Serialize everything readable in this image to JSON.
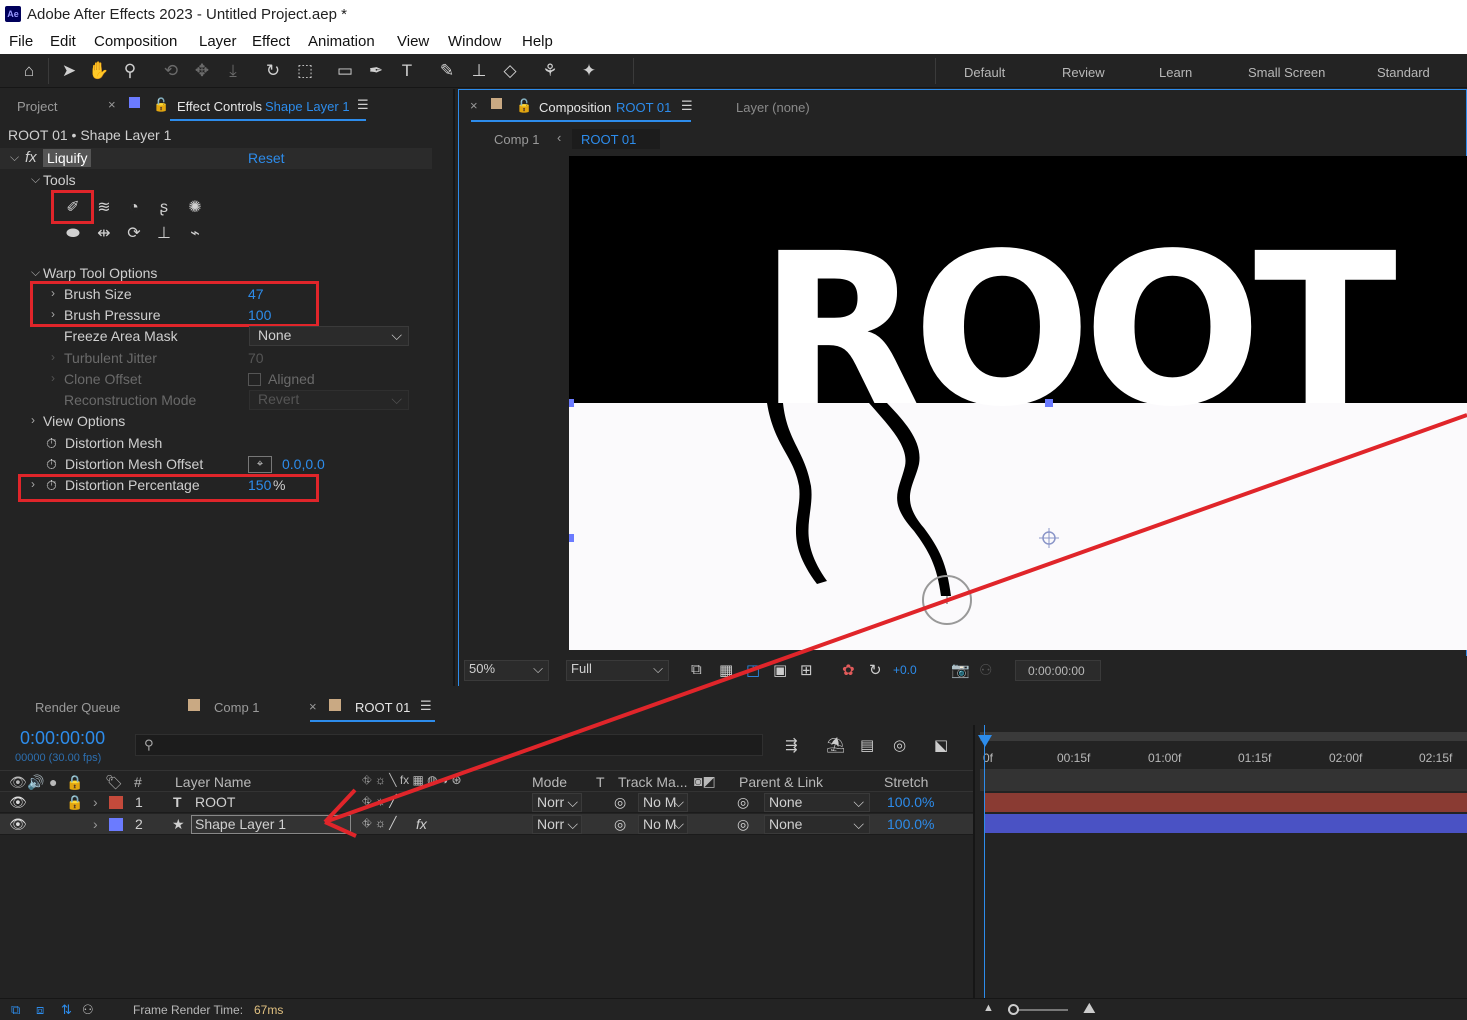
{
  "window": {
    "app_icon": "Ae",
    "title": "Adobe After Effects 2023 - Untitled Project.aep *"
  },
  "menu": [
    "File",
    "Edit",
    "Composition",
    "Layer",
    "Effect",
    "Animation",
    "View",
    "Window",
    "Help"
  ],
  "workspaces": [
    "Default",
    "Review",
    "Learn",
    "Small Screen",
    "Standard"
  ],
  "left_panel": {
    "tab_project": "Project",
    "tab_effect_controls": "Effect Controls",
    "tab_effect_layer": "Shape Layer 1",
    "breadcrumb": "ROOT 01 • Shape Layer 1",
    "effect": {
      "fx": "fx",
      "name": "Liquify",
      "reset": "Reset"
    },
    "tools_label": "Tools",
    "warp_options_label": "Warp Tool Options",
    "brush_size": {
      "label": "Brush Size",
      "value": "47"
    },
    "brush_pressure": {
      "label": "Brush Pressure",
      "value": "100"
    },
    "freeze_area_mask": {
      "label": "Freeze Area Mask",
      "value": "None"
    },
    "turbulent_jitter": {
      "label": "Turbulent Jitter",
      "value": "70"
    },
    "clone_offset": {
      "label": "Clone Offset",
      "checkbox_label": "Aligned"
    },
    "reconstruction_mode": {
      "label": "Reconstruction Mode",
      "value": "Revert"
    },
    "view_options_label": "View Options",
    "distortion_mesh_label": "Distortion Mesh",
    "distortion_mesh_offset": {
      "label": "Distortion Mesh Offset",
      "value": "0.0,0.0"
    },
    "distortion_percentage": {
      "label": "Distortion Percentage",
      "value": "150",
      "unit": "%"
    }
  },
  "viewer": {
    "tab_label": "Composition",
    "tab_comp": "ROOT 01",
    "layer_tab": "Layer (none)",
    "breadcrumbs": [
      "Comp 1",
      "ROOT 01"
    ],
    "comp_text": "ROOT",
    "zoom": "50%",
    "resolution": "Full",
    "exposure": "+0.0",
    "timecode": "0:00:00:00"
  },
  "timeline": {
    "tabs": [
      "Render Queue",
      "Comp 1",
      "ROOT 01"
    ],
    "timecode": "0:00:00:00",
    "fps": "00000 (30.00 fps)",
    "columns": {
      "num": "#",
      "layer_name": "Layer Name",
      "mode": "Mode",
      "t": "T",
      "track_matte": "Track Ma...",
      "parent": "Parent & Link",
      "stretch": "Stretch"
    },
    "ruler": [
      "0f",
      "00:15f",
      "01:00f",
      "01:15f",
      "02:00f",
      "02:15f"
    ],
    "layers": [
      {
        "num": "1",
        "type_icon": "T",
        "name": "ROOT",
        "color": "#c44a3b",
        "mode": "Norr",
        "matte": "No M",
        "parent": "None",
        "stretch": "100.0%",
        "bar_color": "#8a3b33"
      },
      {
        "num": "2",
        "type_icon": "★",
        "name": "Shape Layer 1",
        "color": "#6b7bff",
        "mode": "Norr",
        "matte": "No M",
        "parent": "None",
        "stretch": "100.0%",
        "bar_color": "#4a52c4",
        "fx": "fx"
      }
    ],
    "status_label": "Frame Render Time:",
    "status_value": "67ms"
  },
  "colors": {
    "accent_blue": "#2d8ceb",
    "highlight_red": "#e0252a"
  }
}
